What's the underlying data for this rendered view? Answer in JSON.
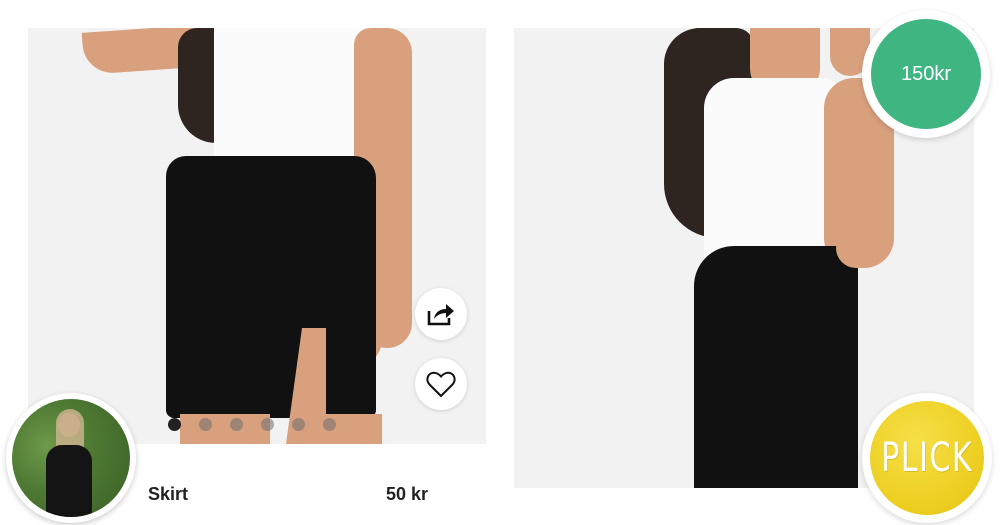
{
  "product": {
    "name": "Skirt",
    "price": "50 kr"
  },
  "carousel": {
    "total": 6,
    "active_index": 0
  },
  "actions": {
    "share_icon": "share-icon",
    "favorite_icon": "heart-icon"
  },
  "badge": {
    "price_label": "150kr",
    "color": "#3fb681"
  },
  "plick": {
    "label": "PLICK",
    "color": "#eccd1e"
  },
  "seller": {
    "avatar_icon": "avatar"
  }
}
